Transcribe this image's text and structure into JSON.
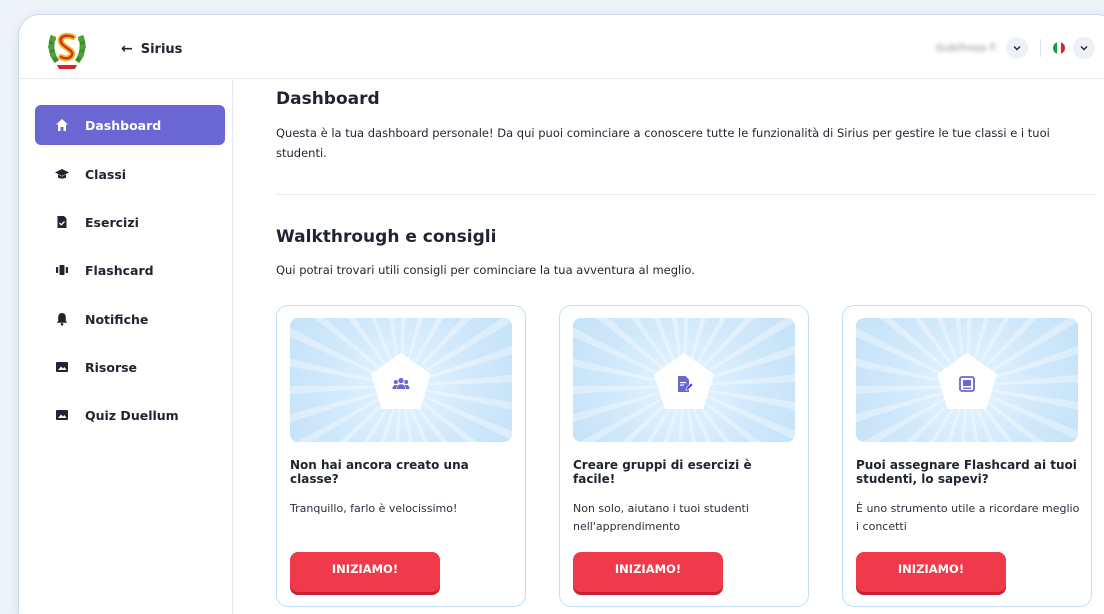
{
  "header": {
    "back_label": "Sirius",
    "user_name": "Gubifrosa F.",
    "flag_colors": [
      "#1f9a3b",
      "#ffffff",
      "#d8232a"
    ]
  },
  "sidebar": {
    "items": [
      {
        "label": "Dashboard",
        "icon": "home-icon",
        "active": true
      },
      {
        "label": "Classi",
        "icon": "graduation-cap-icon",
        "active": false
      },
      {
        "label": "Esercizi",
        "icon": "document-check-icon",
        "active": false
      },
      {
        "label": "Flashcard",
        "icon": "cards-icon",
        "active": false
      },
      {
        "label": "Notifiche",
        "icon": "bell-icon",
        "active": false
      },
      {
        "label": "Risorse",
        "icon": "image-icon",
        "active": false
      },
      {
        "label": "Quiz Duellum",
        "icon": "image-icon",
        "active": false
      }
    ],
    "active_color": "#6a67d4"
  },
  "main": {
    "title": "Dashboard",
    "intro": "Questa è la tua dashboard personale! Da qui puoi cominciare a conoscere tutte le funzionalità di Sirius per gestire le tue classi e i tuoi studenti.",
    "walkthrough_title": "Walkthrough e consigli",
    "walkthrough_subtitle": "Qui potrai trovari utili consigli per cominciare la tua avventura al meglio.",
    "cards": [
      {
        "icon": "users-group-icon",
        "title": "Non hai ancora creato una classe?",
        "desc": "Tranquillo, farlo è velocissimo!",
        "button": "INIZIAMO!"
      },
      {
        "icon": "document-edit-icon",
        "title": "Creare gruppi di esercizi è facile!",
        "desc": "Non solo, aiutano i tuoi studenti nell'apprendimento",
        "button": "INIZIAMO!"
      },
      {
        "icon": "flashcard-icon",
        "title": "Puoi assegnare Flashcard ai tuoi studenti, lo sapevi?",
        "desc": "È uno strumento utile a ricordare meglio i concetti",
        "button": "INIZIAMO!"
      }
    ],
    "button_color": "#f0394b",
    "icon_color": "#6a67d4"
  }
}
